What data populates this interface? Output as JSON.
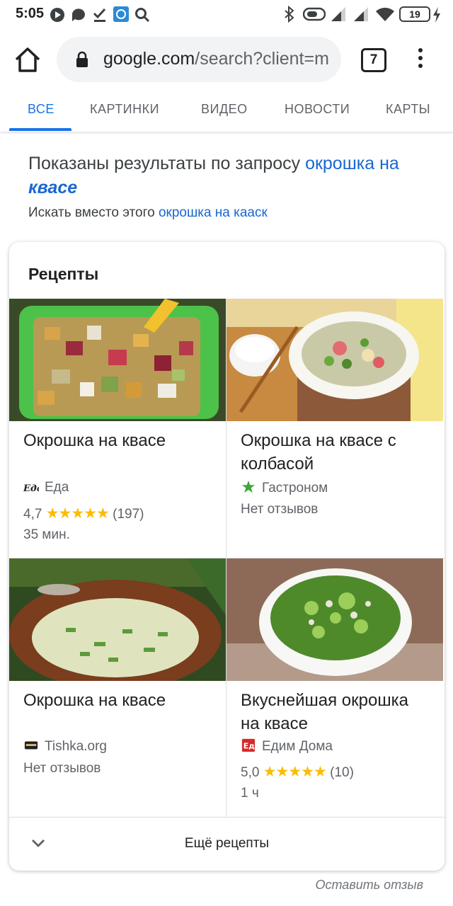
{
  "status_bar": {
    "time": "5:05",
    "battery": "19"
  },
  "browser": {
    "url_domain": "google.com",
    "url_path": "/search?client=m",
    "tab_count": "7"
  },
  "search_tabs": [
    {
      "label": "ВСЕ",
      "active": true
    },
    {
      "label": "КАРТИНКИ",
      "active": false
    },
    {
      "label": "ВИДЕО",
      "active": false
    },
    {
      "label": "НОВОСТИ",
      "active": false
    },
    {
      "label": "КАРТЫ",
      "active": false
    }
  ],
  "correction": {
    "prefix": "Показаны результаты по запросу ",
    "query_part1": "окрошка на",
    "query_part2": "квасе",
    "instead_prefix": "Искать вместо этого ",
    "instead_query": "окрошка на кааск"
  },
  "recipes_card": {
    "title": "Рецепты",
    "items": [
      {
        "title": "Окрошка на квасе",
        "source": "Еда",
        "source_icon": "eda-logo-icon",
        "rating": "4,7",
        "stars": "★★★★★",
        "reviews": "(197)",
        "time": "35 мин.",
        "no_reviews": ""
      },
      {
        "title": "Окрошка на квасе с колбасой",
        "source": "Гастроном",
        "source_icon": "gastronom-star-icon",
        "rating": "",
        "stars": "",
        "reviews": "",
        "time": "",
        "no_reviews": "Нет отзывов"
      },
      {
        "title": "Окрошка на квасе",
        "source": "Tishka.org",
        "source_icon": "tishka-logo-icon",
        "rating": "",
        "stars": "",
        "reviews": "",
        "time": "",
        "no_reviews": "Нет отзывов"
      },
      {
        "title": "Вкуснейшая окрошка на квасе",
        "source": "Едим Дома",
        "source_icon": "edim-doma-logo-icon",
        "rating": "5,0",
        "stars": "★★★★★",
        "reviews": "(10)",
        "time": "1 ч",
        "no_reviews": ""
      }
    ],
    "more_label": "Ещё рецепты"
  },
  "feedback_link": "Оставить отзыв",
  "colors": {
    "link": "#1967d2",
    "active_tab": "#1a73e8",
    "star": "#fbbc04"
  }
}
